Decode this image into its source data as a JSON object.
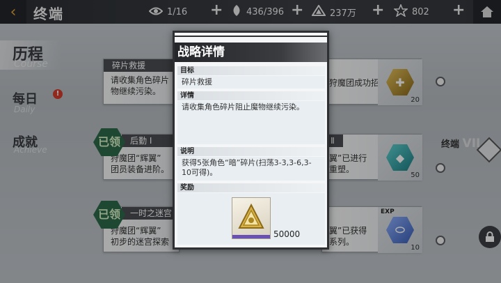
{
  "header": {
    "back_icon": "back-arrow-icon",
    "title": "终端",
    "resources": [
      {
        "icon": "eye-icon",
        "value": "1/16"
      },
      {
        "icon": "stamina-icon",
        "value": "436/396"
      },
      {
        "icon": "coin-icon",
        "value": "237万"
      },
      {
        "icon": "star-badge-icon",
        "value": "802"
      }
    ],
    "plus_label": "+",
    "home_icon": "home-icon"
  },
  "nav": {
    "items": [
      {
        "label": "历程",
        "sub": "Course"
      },
      {
        "label": "每日",
        "sub": "Daily",
        "alert": "!"
      },
      {
        "label": "成就",
        "sub": "Achieve"
      }
    ]
  },
  "cards": [
    {
      "head": "碎片救援",
      "line1": "请收集角色碎片",
      "line2": "物继续污染。"
    },
    {
      "head": "",
      "line1": "狩魔团成功招",
      "num": "20"
    },
    {
      "head": "后勤 Ⅰ",
      "line1": "狩魔团“辉翼”",
      "line2": "团员装备进阶。",
      "claimed": "已领"
    },
    {
      "head": "Ⅱ",
      "line1": "翼”已进行",
      "line2": "重塑。",
      "num": "50"
    },
    {
      "head": "一时之迷宫",
      "line1": "狩魔团“辉翼”",
      "line2": "初步的迷宫探索",
      "claimed": "已领"
    },
    {
      "head": "",
      "line1": "翼”已获得",
      "line2": "系列。",
      "num": "10",
      "tag": "EXP"
    }
  ],
  "side": {
    "label": "终端",
    "roman": "VII"
  },
  "modal": {
    "title": "战略详情",
    "goal_label": "目标",
    "goal_value": "碎片救援",
    "detail_label": "详情",
    "detail_value": "请收集角色碎片阻止魔物继续污染。",
    "note_label": "说明",
    "note_value": "获得5张角色“暗”碎片(扫荡3-3,3-6,3-10可得)。",
    "reward_label": "奖励",
    "reward_icon": "emblem-icon",
    "reward_count": "50000"
  }
}
